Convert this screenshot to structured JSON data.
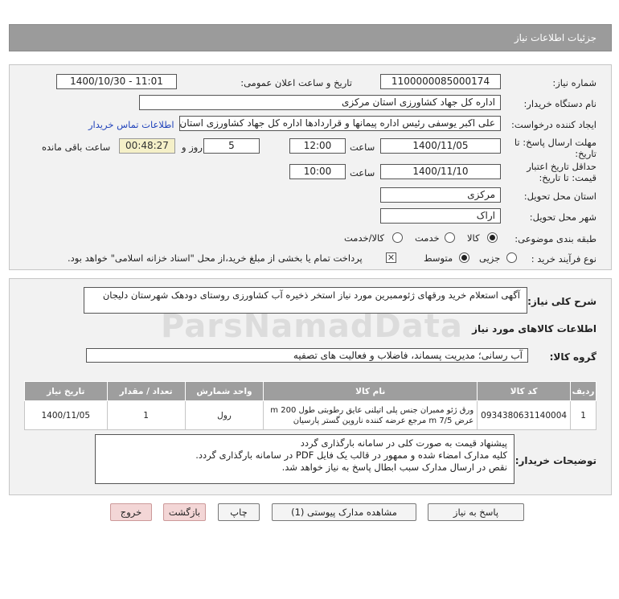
{
  "header": {
    "title": "جزئیات اطلاعات نیاز"
  },
  "form": {
    "need_number_label": "شماره نیاز:",
    "need_number": "1100000085000174",
    "announce_label": "تاریخ و ساعت اعلان عمومی:",
    "announce_value": "1400/10/30 - 11:01",
    "buyer_org_label": "نام دستگاه خریدار:",
    "buyer_org": "اداره کل جهاد کشاورزی استان مرکزی",
    "creator_label": "ایجاد کننده درخواست:",
    "creator": "علی اکبر یوسفی رئیس اداره پیمانها و قراردادها اداره کل جهاد کشاورزی استان مرکزی",
    "contact_link": "اطلاعات تماس خریدار",
    "deadline_label": "مهلت ارسال پاسخ: تا تاریخ:",
    "deadline_date": "1400/11/05",
    "time_label": "ساعت",
    "deadline_time": "12:00",
    "days_value": "5",
    "days_label": "روز و",
    "timer_value": "00:48:27",
    "remaining_label": "ساعت باقی مانده",
    "validity_label": "حداقل تاریخ اعتبار قیمت: تا تاریخ:",
    "validity_date": "1400/11/10",
    "validity_time": "10:00",
    "province_label": "استان محل تحویل:",
    "province": "مرکزی",
    "city_label": "شهر محل تحویل:",
    "city": "اراک",
    "category_label": "طبقه بندی موضوعی:",
    "category_options": [
      "کالا",
      "خدمت",
      "کالا/خدمت"
    ],
    "process_label": "نوع فرآیند خرید :",
    "process_options": [
      "جزیی",
      "متوسط"
    ],
    "payment_note": "پرداخت تمام یا بخشی از مبلغ خرید،از محل \"اسناد خزانه اسلامی\" خواهد بود."
  },
  "details": {
    "summary_label": "شرح کلی نیاز:",
    "summary": "آگهی استعلام  خرید ورقهای ژئوممبرین مورد نیاز استخر ذخیره آب کشاورزی روستای دودهک شهرستان دلیجان",
    "goods_info_title": "اطلاعات کالاهای مورد نیاز",
    "goods_group_label": "گروه کالا:",
    "goods_group": "آب رسانی؛ مدیریت پسماند، فاضلاب و فعالیت های تصفیه",
    "table_headers": [
      "ردیف",
      "کد کالا",
      "نام کالا",
      "واحد شمارش",
      "تعداد / مقدار",
      "تاریخ نیاز"
    ],
    "rows": [
      {
        "row": "1",
        "code": "0934380631140004",
        "name": "ورق ژئو ممبران جنس پلی اتیلنی عایق رطوبتی طول 200 m عرض 7/5 m مرجع عرضه کننده ناروین گستر پارسیان",
        "unit": "رول",
        "qty": "1",
        "date": "1400/11/05"
      }
    ],
    "buyer_notes_label": "توضیحات خریدار:",
    "buyer_notes": "پیشنهاد قیمت به صورت کلی در سامانه بارگذاری گردد\nکلیه مدارک امضاء شده و ممهور در قالب یک فایل PDF  در سامانه بارگذاری گردد.\nنقص در ارسال مدارک سبب ابطال پاسخ به نیاز خواهد شد."
  },
  "buttons": {
    "reply": "پاسخ به نیاز",
    "attachments": "مشاهده مدارک پیوستی (1)",
    "print": "چاپ",
    "back": "بازگشت",
    "exit": "خروج"
  },
  "watermark": "ParsNamadData"
}
